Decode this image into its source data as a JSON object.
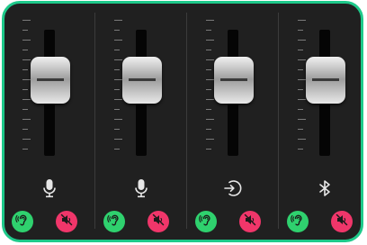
{
  "colors": {
    "accent": "#1ec98a",
    "panel": "#202020",
    "listen": "#2fd16e",
    "mute": "#f0366a"
  },
  "channels": [
    {
      "source_icon": "microphone-icon",
      "fader_level": 0.6,
      "listen_icon": "ear-icon",
      "mute_icon": "speaker-muted-icon"
    },
    {
      "source_icon": "microphone-icon",
      "fader_level": 0.6,
      "listen_icon": "ear-icon",
      "mute_icon": "speaker-muted-icon"
    },
    {
      "source_icon": "input-icon",
      "fader_level": 0.6,
      "listen_icon": "ear-icon",
      "mute_icon": "speaker-muted-icon"
    },
    {
      "source_icon": "bluetooth-icon",
      "fader_level": 0.6,
      "listen_icon": "ear-icon",
      "mute_icon": "speaker-muted-icon"
    }
  ]
}
